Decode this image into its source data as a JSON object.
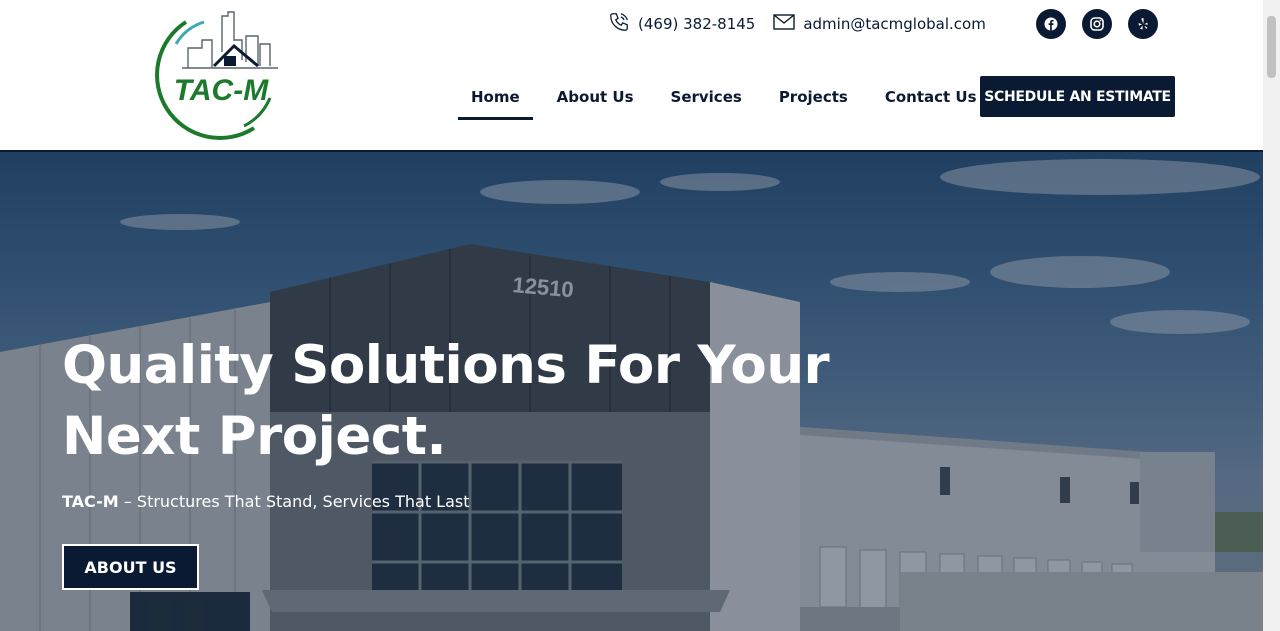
{
  "brand": {
    "logo_text": "TAC-M"
  },
  "topbar": {
    "phone": "(469) 382-8145",
    "email": "admin@tacmglobal.com",
    "socials": [
      "facebook-icon",
      "instagram-icon",
      "yelp-icon"
    ]
  },
  "nav": {
    "items": [
      {
        "label": "Home",
        "active": true
      },
      {
        "label": "About Us",
        "active": false
      },
      {
        "label": "Services",
        "active": false
      },
      {
        "label": "Projects",
        "active": false
      },
      {
        "label": "Contact Us",
        "active": false
      }
    ],
    "cta_label": "SCHEDULE AN ESTIMATE"
  },
  "hero": {
    "title_line1": "Quality Solutions For Your",
    "title_line2": "Next Project.",
    "subtitle_brand": "TAC-M",
    "subtitle_rest": " – Structures That Stand, Services That Last",
    "button_label": "ABOUT US",
    "building_number": "12510"
  },
  "colors": {
    "navy": "#0b1a33",
    "logo_green": "#1c7a2c",
    "logo_teal": "#3aa9b5",
    "white": "#ffffff"
  }
}
